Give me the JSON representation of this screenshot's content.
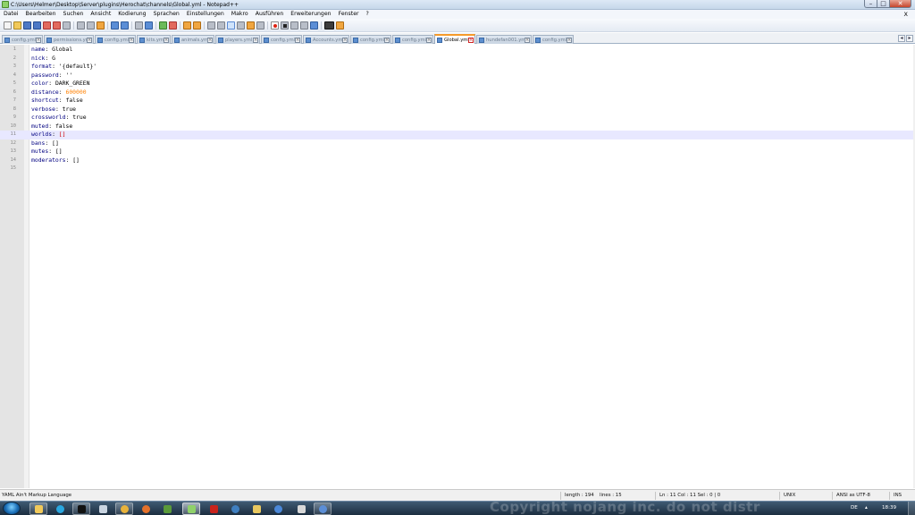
{
  "window": {
    "title": "C:\\Users\\Helmer\\Desktop\\Server\\plugins\\Herochat\\channels\\Global.yml - Notepad++"
  },
  "menu": {
    "items": [
      "Datei",
      "Bearbeiten",
      "Suchen",
      "Ansicht",
      "Kodierung",
      "Sprachen",
      "Einstellungen",
      "Makro",
      "Ausführen",
      "Erweiterungen",
      "Fenster",
      "?"
    ],
    "close_label": "X"
  },
  "tabs": [
    {
      "label": "config.yml"
    },
    {
      "label": "permissions.yml"
    },
    {
      "label": "config.yml"
    },
    {
      "label": "kits.yml"
    },
    {
      "label": "animals.yml"
    },
    {
      "label": "players.yml"
    },
    {
      "label": "config.yml"
    },
    {
      "label": "Accounts.yml"
    },
    {
      "label": "config.yml"
    },
    {
      "label": "config.yml"
    },
    {
      "label": "Global.yml"
    },
    {
      "label": "hundefan001.yml"
    },
    {
      "label": "config.yml"
    }
  ],
  "active_tab_label": "Global.yml",
  "tab_scroll": {
    "left": "◂",
    "right": "▸"
  },
  "editor": {
    "current_line": 11,
    "lines": [
      {
        "n": "1",
        "key": "name",
        "value": "Global"
      },
      {
        "n": "2",
        "key": "nick",
        "value": "G"
      },
      {
        "n": "3",
        "key": "format",
        "value": "'{default}'"
      },
      {
        "n": "4",
        "key": "password",
        "value": "''"
      },
      {
        "n": "5",
        "key": "color",
        "value": "DARK_GREEN"
      },
      {
        "n": "6",
        "key": "distance",
        "value": "600000"
      },
      {
        "n": "7",
        "key": "shortcut",
        "value": "false"
      },
      {
        "n": "8",
        "key": "verbose",
        "value": "true"
      },
      {
        "n": "9",
        "key": "crossworld",
        "value": "true"
      },
      {
        "n": "10",
        "key": "muted",
        "value": "false"
      },
      {
        "n": "11",
        "key": "worlds",
        "value": "[]"
      },
      {
        "n": "12",
        "key": "bans",
        "value": "[]"
      },
      {
        "n": "13",
        "key": "mutes",
        "value": "[]"
      },
      {
        "n": "14",
        "key": "moderators",
        "value": "[]"
      },
      {
        "n": "15",
        "key": "",
        "value": ""
      }
    ]
  },
  "status": {
    "language": "YAML Ain't Markup Language",
    "length": "length : 194",
    "lines": "lines : 15",
    "position": "Ln : 11    Col : 11    Sel : 0 | 0",
    "eol": "UNIX",
    "encoding": "ANSI as UTF-8",
    "mode": "INS"
  },
  "taskbar": {
    "watermark": "Copyright nojang inc. do not distr",
    "lang": "DE",
    "clock": "18:39"
  },
  "colors": {
    "key": "#000080",
    "number": "#ff8000",
    "bracket_highlight": "#d00000",
    "current_line": "#e8e8ff",
    "active_tab_accent": "#f59a2a"
  }
}
